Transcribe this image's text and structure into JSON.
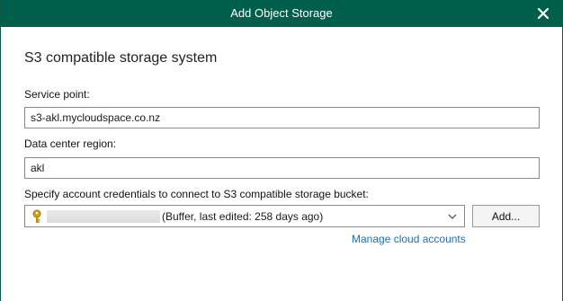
{
  "window": {
    "title": "Add Object Storage"
  },
  "page": {
    "heading": "S3 compatible storage system"
  },
  "service_point": {
    "label": "Service point:",
    "value": "s3-akl.mycloudspace.co.nz"
  },
  "region": {
    "label": "Data center region:",
    "value": "akl"
  },
  "credentials": {
    "label": "Specify account credentials to connect to S3 compatible storage bucket:",
    "selected_text": "(Buffer, last edited: 258 days ago)",
    "add_label": "Add...",
    "manage_link": "Manage cloud accounts"
  },
  "colors": {
    "titlebar": "#005f4b",
    "link": "#1f6fa8"
  }
}
